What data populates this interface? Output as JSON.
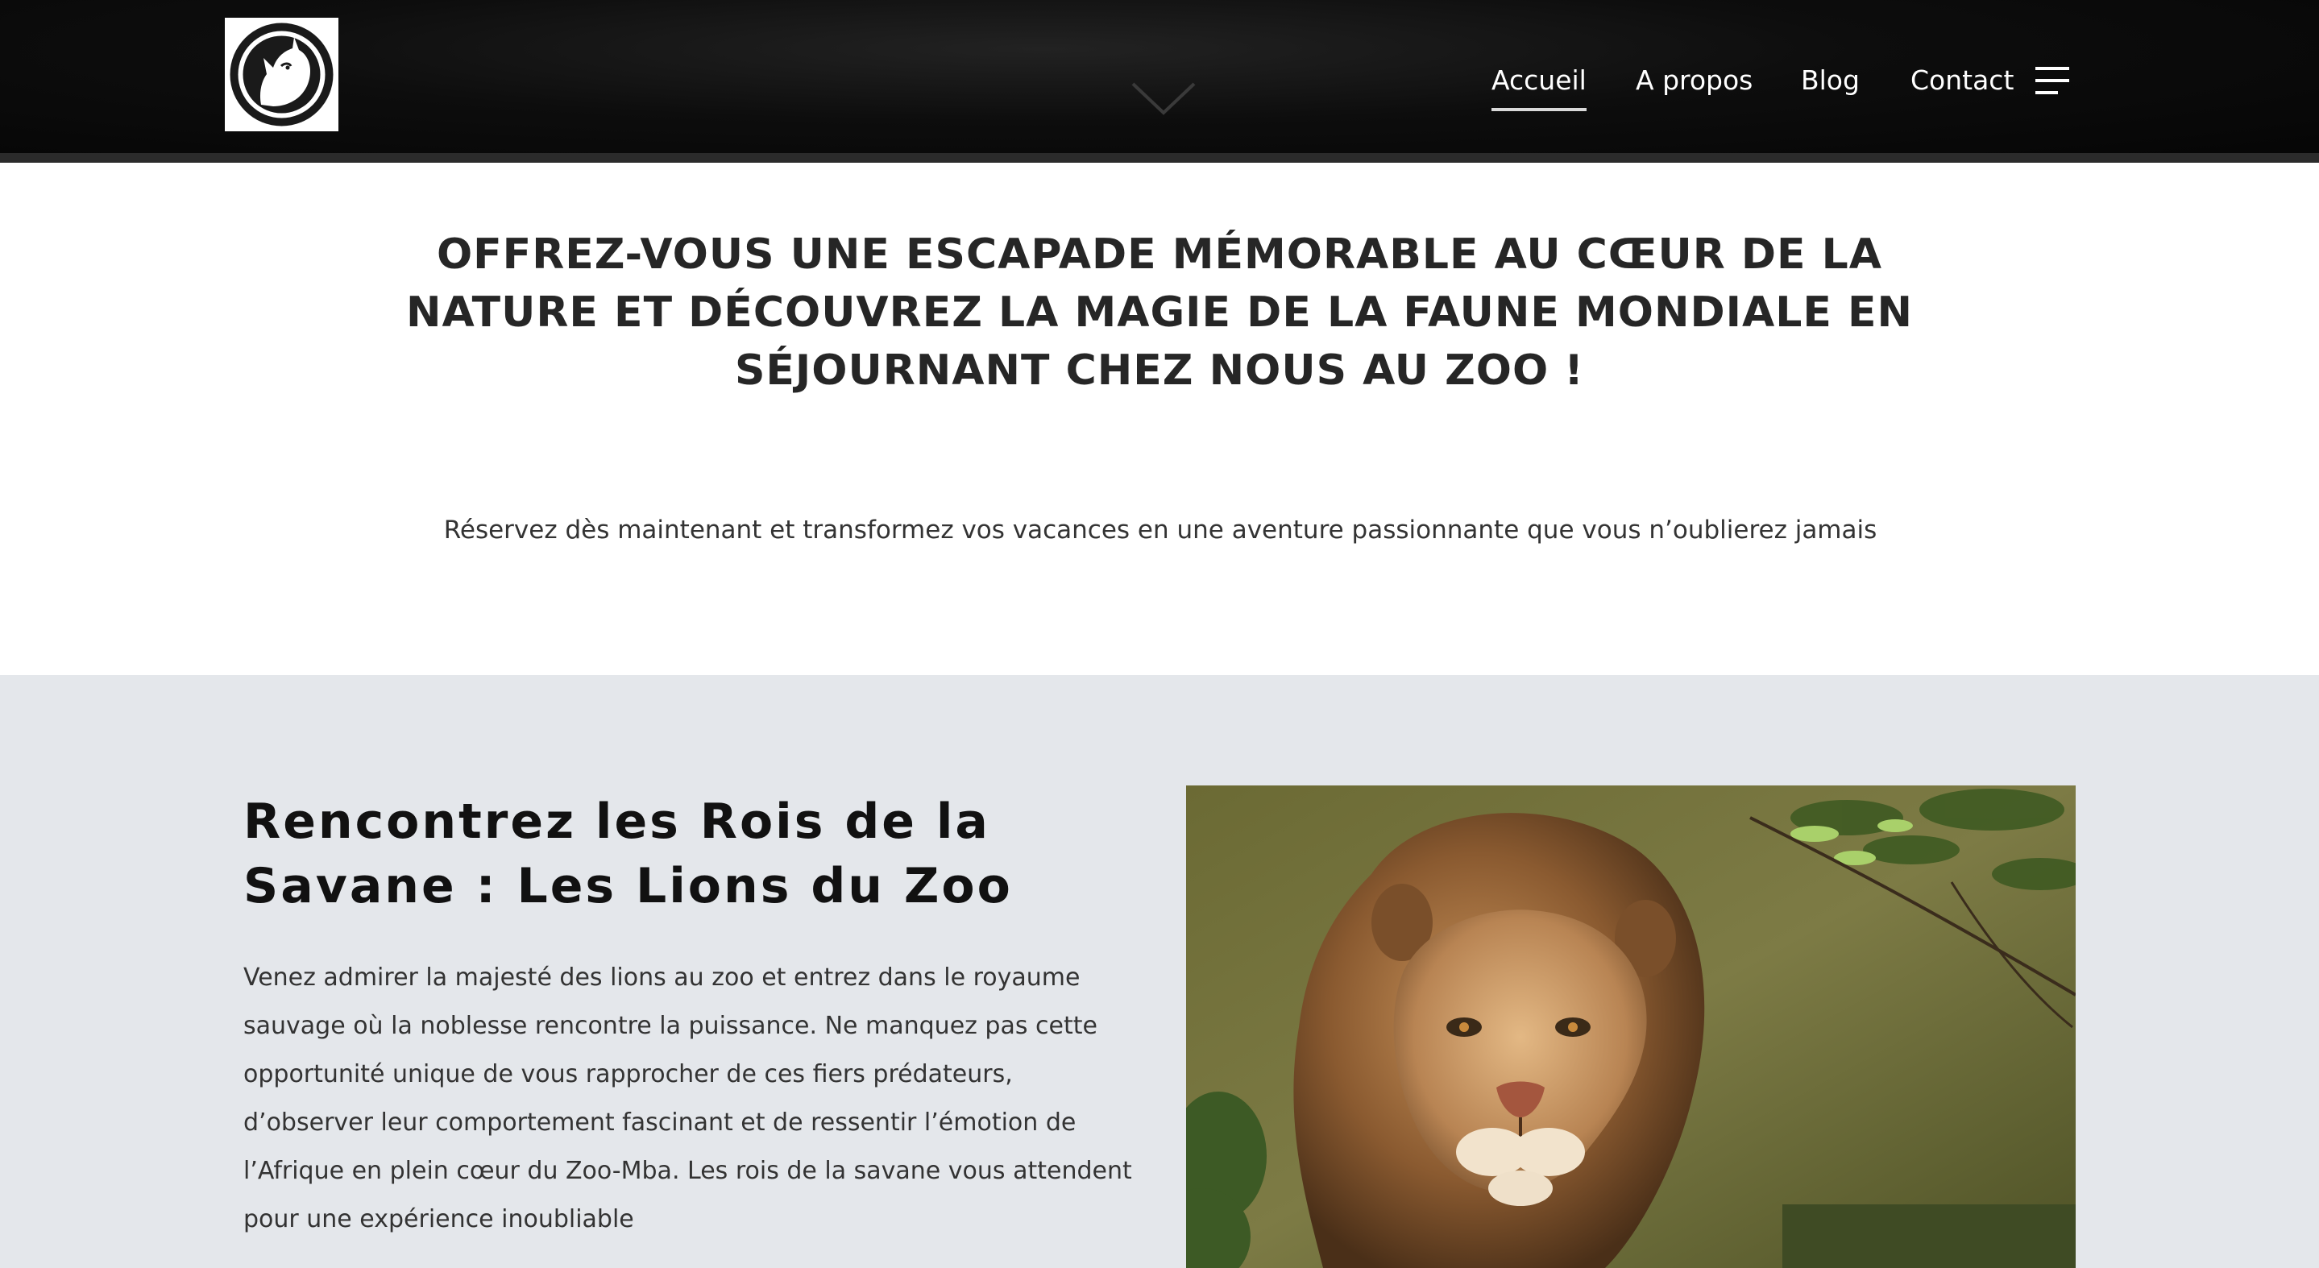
{
  "header": {
    "logo_icon": "rhino-logo-icon",
    "scroll_icon": "chevron-down-icon",
    "nav": [
      {
        "label": "Accueil",
        "active": true
      },
      {
        "label": "A propos",
        "active": false
      },
      {
        "label": "Blog",
        "active": false
      },
      {
        "label": "Contact",
        "active": false
      }
    ],
    "menu_icon": "hamburger-menu-icon"
  },
  "intro": {
    "title": "OFFREZ-VOUS UNE ESCAPADE MÉMORABLE AU CŒUR DE LA NATURE ET DÉCOUVREZ LA MAGIE DE LA FAUNE MONDIALE EN SÉJOURNANT CHEZ NOUS AU ZOO !",
    "subtitle": "Réservez dès maintenant et transformez vos vacances en une aventure passionnante que vous n’oublierez jamais"
  },
  "lions": {
    "title": "Rencontrez les Rois de la Savane : Les Lions du Zoo",
    "text": "Venez admirer la majesté des lions au zoo et entrez dans le royaume sauvage où la noblesse rencontre la puissance. Ne manquez pas cette opportunité unique de vous rapprocher de ces fiers prédateurs, d’observer leur comportement fascinant et de ressentir l’émotion de l’Afrique en plein cœur du Zoo-Mba. Les rois de la savane vous attendent pour une expérience inoubliable",
    "image": "lion-photo"
  },
  "colors": {
    "header_bg": "#0b0b0b",
    "section_bg": "#e4e7eb",
    "heading_text": "#262626",
    "body_text": "#333333",
    "nav_text": "#ffffff"
  }
}
